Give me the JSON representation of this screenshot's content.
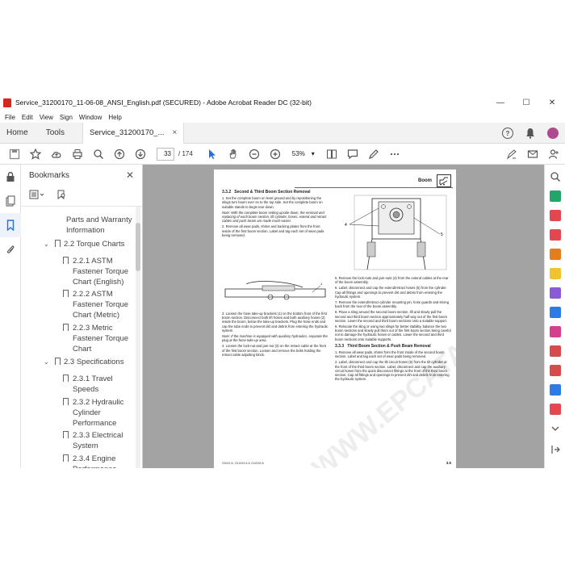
{
  "window": {
    "title": "Service_31200170_11-06-08_ANSI_English.pdf (SECURED) - Adobe Acrobat Reader DC (32-bit)",
    "minimize": "—",
    "maximize": "☐",
    "close": "✕"
  },
  "menu": [
    "File",
    "Edit",
    "View",
    "Sign",
    "Window",
    "Help"
  ],
  "tabs": {
    "home": "Home",
    "tools": "Tools",
    "doc": "Service_31200170_...",
    "doc_close": "×"
  },
  "toolbar": {
    "page_current": "33",
    "page_total": "/ 174",
    "zoom": "53%"
  },
  "bookmarks": {
    "title": "Bookmarks",
    "close": "✕",
    "items": [
      {
        "label": "Parts and Warranty Information"
      },
      {
        "label": "2.2 Torque Charts"
      },
      {
        "label": "2.2.1 ASTM Fastener Torque Chart (English)"
      },
      {
        "label": "2.2.2 ASTM Fastener Torque Chart (Metric)"
      },
      {
        "label": "2.2.3 Metric Fastener Torque Chart"
      },
      {
        "label": "2.3 Specifications"
      },
      {
        "label": "2.3.1 Travel Speeds"
      },
      {
        "label": "2.3.2 Hydraulic Cylinder Performance"
      },
      {
        "label": "2.3.3 Electrical System"
      },
      {
        "label": "2.3.4 Engine Performance"
      }
    ]
  },
  "page": {
    "header": "Boom",
    "sec1_num": "3.3.2",
    "sec1_title": "Second & Third Boom Section Removal",
    "p1": "1. Set the complete boom on level ground and by repositioning the slings turn boom over on to the top side. Set the complete boom on suitable stands to begin tear down.",
    "note1": "Note: With the complete boom setting upside down, the removal and replacing of each boom section, lift cylinder, hoses, extend and retract cables and push beam are made much easier.",
    "p2": "2. Remove all wear pads, shims and backing plates from the front inside of the first boom section. Label and tag each set of wear pads being removed.",
    "p3": "3. Loosen the hose take-up brackets (1) on the bottom front of the first boom section. Disconnect both lift hoses and both auxiliary hoses (2) inside the boom, below the take-up brackets. Plug the hose ends and cap the tube ends to prevent dirt and debris from entering the hydraulic system.",
    "note2": "Note: If the machine is equipped with auxiliary hydraulics, separate the plug at the hose take-up area.",
    "p4": "4. Loosen the lock-nut and jam-nut (3) on the retract cable at the front of the first boom section. Loosen and remove the bolts holding the retract cable adjusting block.",
    "p5": "5. Remove the lock-nuts and jam-nuts (4) from the extend cables at the rear of the boom assembly.",
    "p6": "6. Label, disconnect and cap the extend/retract hoses (5) from the cylinder. Cap all fittings and openings to prevent dirt and debris from entering the hydraulic system.",
    "p7": "7. Remove the extend/retract cylinder mounting pin, hose guards and strong back from the rear of the boom assembly.",
    "p8": "8. Place a sling around the second boom section, lift and slowly pull the second and third boom section approximately half way out of the first boom section. Lower the second and third boom sections onto a suitable support.",
    "p9": "9. Relocate the sling or using two slings for better stability, balance the two boom sections and slowly pull them out of the first boom section being careful not to damage the hydraulic hoses or cables. Lower the second and third boom sections onto suitable supports.",
    "sec2_num": "3.3.3",
    "sec2_title": "Third Boom Section & Push Beam Removal",
    "q1": "1. Remove all wear pads, shims from the front inside of the second boom section. Label and tag each set of wear pads being removed.",
    "q2": "2. Label, disconnect and cap the tilt circuit hoses (6) from the tilt cylinder at the front of the third boom section. Label, disconnect and cap the auxiliary circuit hoses from the quick disconnect fittings at the front of the third boom section. Cap all fittings and openings to prevent dirt and debris from entering the hydraulic system.",
    "footer_left": "G9/43 A, G10/43 A & G10/55 A",
    "footer_right": "3.5",
    "watermark": "WWW.EPCATALOGS.COM"
  },
  "colors": {
    "accent_red": "#d7281d",
    "doc_bg": "#a3a3a3"
  }
}
